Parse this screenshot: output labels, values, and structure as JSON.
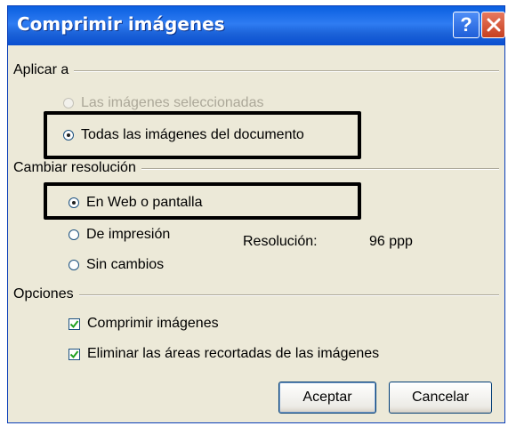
{
  "window": {
    "title": "Comprimir imágenes",
    "help_label": "?"
  },
  "apply_to": {
    "label": "Aplicar a",
    "options": [
      {
        "label": "Las imágenes seleccionadas",
        "state": "disabled"
      },
      {
        "label": "Todas las imágenes del documento",
        "state": "selected"
      }
    ]
  },
  "resolution": {
    "label": "Cambiar resolución",
    "options": [
      {
        "label": "En Web o pantalla",
        "state": "selected"
      },
      {
        "label": "De impresión",
        "state": "unselected"
      },
      {
        "label": "Sin cambios",
        "state": "unselected"
      }
    ],
    "value_label": "Resolución:",
    "value": "96 ppp"
  },
  "options_group": {
    "label": "Opciones",
    "checkboxes": [
      {
        "label": "Comprimir imágenes",
        "checked": true
      },
      {
        "label": "Eliminar las áreas recortadas de las imágenes",
        "checked": true
      }
    ]
  },
  "buttons": {
    "ok": "Aceptar",
    "cancel": "Cancelar"
  },
  "colors": {
    "titlebar": "#0a5fe0",
    "dialog_bg": "#ece9d8",
    "highlight_box": "#000000"
  }
}
